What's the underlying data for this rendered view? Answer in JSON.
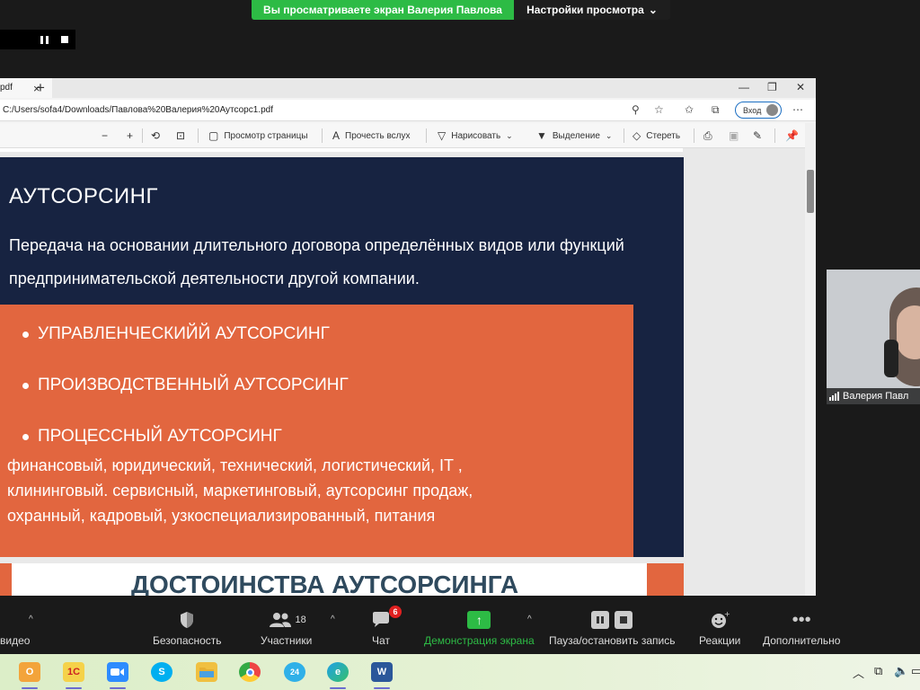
{
  "zoom": {
    "banner_sharing": "Вы просматриваете экран Валерия Павлова",
    "banner_view_options": "Настройки просмотра",
    "webcam_name": "Валерия Павл",
    "toolbar": {
      "video_label": "видео",
      "security_label": "Безопасность",
      "participants_label": "Участники",
      "participants_count": "18",
      "chat_label": "Чат",
      "chat_badge": "6",
      "share_label": "Демонстрация экрана",
      "record_label": "Пауза/остановить запись",
      "reactions_label": "Реакции",
      "more_label": "Дополнительно"
    }
  },
  "browser": {
    "tab_title": "pdf",
    "url": "C:/Users/sofa4/Downloads/Павлова%20Валерия%20Аутсорс1.pdf",
    "login_label": "Вход",
    "pdf_toolbar": {
      "page_view": "Просмотр страницы",
      "read_aloud": "Прочесть вслух",
      "draw": "Нарисовать",
      "highlight": "Выделение",
      "erase": "Стереть"
    }
  },
  "slide1": {
    "title": "АУТСОРСИНГ",
    "description": "Передача на основании длительного договора определённых видов или функций предпринимательской деятельности другой компании.",
    "bullets": [
      "УПРАВЛЕНЧЕСКИЙЙ АУТСОРСИНГ",
      "ПРОИЗВОДСТВЕННЫЙ АУТСОРСИНГ",
      "ПРОЦЕССНЫЙ АУТСОРСИНГ"
    ],
    "types_line1": "финансовый, юридический, технический, логистический, IT ,",
    "types_line2": "клининговый. сервисный, маркетинговый, аутсорсинг продаж,",
    "types_line3": "охранный,  кадровый, узкоспециализированный, питания"
  },
  "slide2": {
    "title": "ДОСТОИНСТВА АУТСОРСИНГА"
  },
  "taskbar": {
    "zoom_badge": "24",
    "word_letter": "W"
  },
  "colors": {
    "slide_navy": "#172341",
    "slide_orange": "#e2663f",
    "zoom_green": "#2dbb45"
  }
}
